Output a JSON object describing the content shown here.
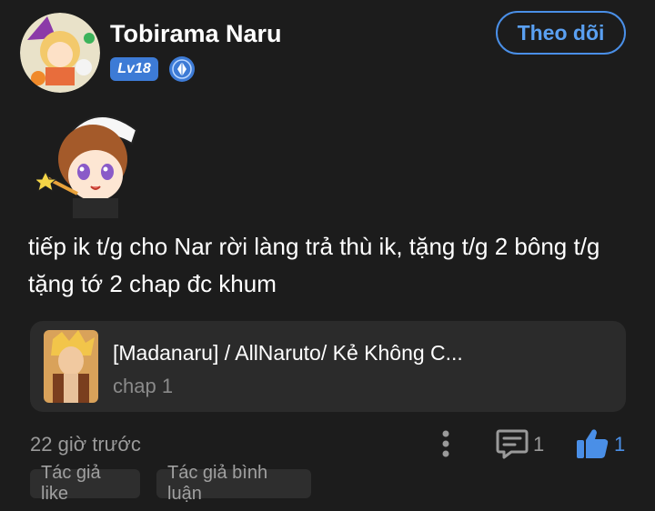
{
  "user": {
    "name": "Tobirama Naru",
    "level": "Lv18"
  },
  "follow_button": "Theo dõi",
  "comment": {
    "text": "tiếp ik t/g cho Nar rời làng trả thù ik, tặng t/g 2 bông t/g tặng tớ 2 chap đc khum"
  },
  "book": {
    "title": "[Madanaru] / AllNaruto/ Kẻ Không C...",
    "chapter": "chap 1"
  },
  "meta": {
    "time": "22 giờ trước",
    "comment_count": "1",
    "like_count": "1"
  },
  "tags": [
    "Tác giả like",
    "Tác giả bình luận"
  ],
  "icons": {
    "verify": "diamond-verify-icon",
    "more": "more-vertical-icon",
    "comment": "comment-icon",
    "like": "thumbs-up-icon"
  },
  "colors": {
    "accent": "#4a8fe7",
    "background": "#1c1c1c",
    "card": "#2b2b2b"
  }
}
